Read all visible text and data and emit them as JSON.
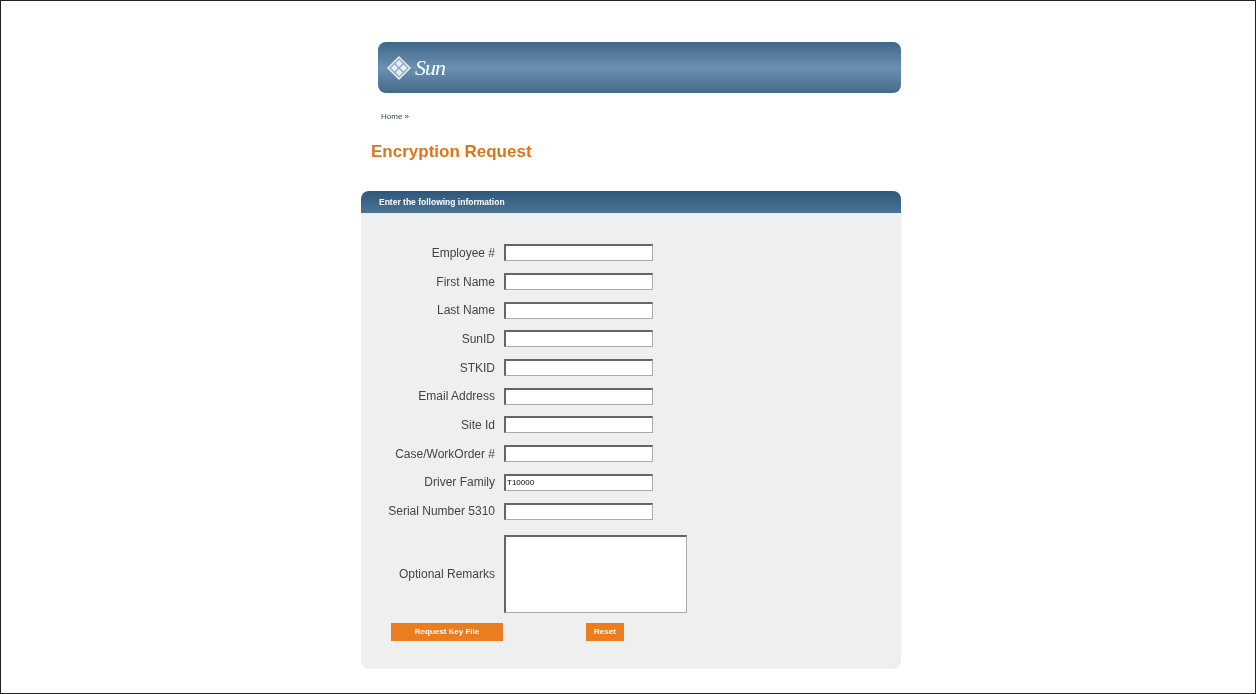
{
  "header": {
    "logo_text": "Sun"
  },
  "breadcrumb": "Home »",
  "title": "Encryption Request",
  "section_header": "Enter the following information",
  "fields": [
    {
      "kind": "input",
      "label": "Employee #"
    },
    {
      "kind": "input",
      "label": "First Name"
    },
    {
      "kind": "input",
      "label": "Last Name"
    },
    {
      "kind": "input",
      "label": "SunID"
    },
    {
      "kind": "input",
      "label": "STKID"
    },
    {
      "kind": "input",
      "label": "Email Address"
    },
    {
      "kind": "input",
      "label": "Site Id"
    },
    {
      "kind": "input",
      "label": "Case/WorkOrder #"
    },
    {
      "kind": "input",
      "label": "Driver Family",
      "value": "T10000"
    },
    {
      "kind": "input",
      "label": "Serial Number 5310"
    },
    {
      "kind": "textarea",
      "label": "Optional Remarks"
    }
  ],
  "buttons": [
    "Request Key File",
    "Reset"
  ]
}
